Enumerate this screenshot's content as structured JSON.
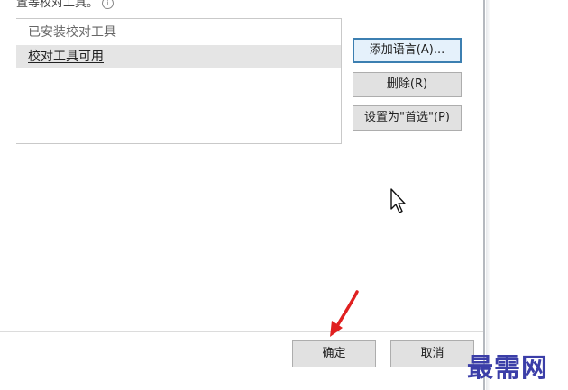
{
  "section": {
    "label": "置等校对工具。"
  },
  "list": {
    "items": [
      {
        "label": "已安装校对工具",
        "selected": false
      },
      {
        "label": "校对工具可用",
        "selected": true
      }
    ]
  },
  "buttons": {
    "add_language": "添加语言(A)...",
    "delete": "删除(R)",
    "set_default": "设置为\"首选\"(P)"
  },
  "footer": {
    "ok": "确定",
    "cancel": "取消"
  },
  "watermark": {
    "text": "最需网"
  },
  "colors": {
    "accent_focus": "#3c7fb1",
    "arrow": "#e02020",
    "watermark": "#3b3ea8"
  },
  "icons": {
    "info": "info-icon",
    "cursor": "mouse-pointer-icon",
    "annotation": "red-arrow-icon"
  }
}
